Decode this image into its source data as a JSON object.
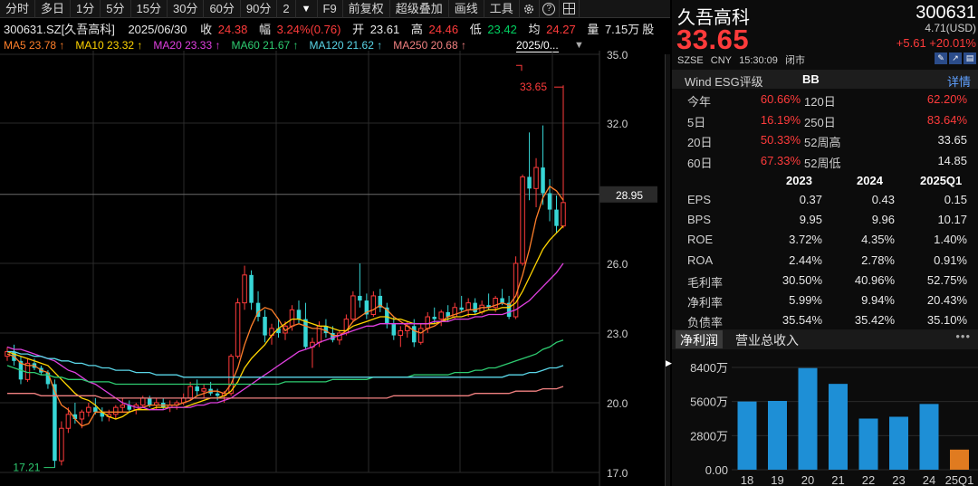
{
  "toolbar": {
    "items": [
      "分时",
      "多日",
      "1分",
      "5分",
      "15分",
      "30分",
      "60分",
      "90分",
      "2"
    ],
    "more_arrow": "▼",
    "f9": "F9",
    "adjust": "前复权",
    "overlay": "超级叠加",
    "draw": "画线",
    "tools": "工具",
    "settings_icon": "gear-icon",
    "help": "?",
    "help_icon": "question-icon",
    "grid_icon": "grid-icon"
  },
  "quote": {
    "code_name": "300631.SZ[久吾高科]",
    "date": "2025/06/30",
    "close_label": "收",
    "close": "24.38",
    "amp_label": "幅",
    "amp": "3.24%(0.76)",
    "open_label": "开",
    "open": "23.61",
    "high_label": "高",
    "high": "24.46",
    "low_label": "低",
    "low": "23.42",
    "avg_label": "均",
    "avg": "24.27",
    "vol_label": "量",
    "vol": "7.15万",
    "trail": "股"
  },
  "ma_legend": [
    {
      "text": "MA5 23.78 ↑",
      "color": "#ff7f2a"
    },
    {
      "text": "MA10 23.32 ↑",
      "color": "#ffd400"
    },
    {
      "text": "MA20 23.33 ↑",
      "color": "#e040e0"
    },
    {
      "text": "MA60 21.67 ↑",
      "color": "#2ecc71"
    },
    {
      "text": "MA120 21.62 ↑",
      "color": "#5ad6e8"
    },
    {
      "text": "MA250 20.68 ↑",
      "color": "#f08080"
    }
  ],
  "ma_date": "2025/0...",
  "ma_drop": "▼",
  "chart_data": {
    "type": "candlestick",
    "y_ticks": [
      "35.0",
      "32.0",
      "26.0",
      "23.0",
      "20.0",
      "17.0"
    ],
    "y_range": [
      17.0,
      35.0
    ],
    "current_price_label": "28.95",
    "current_price": 28.95,
    "high_marker": "33.65",
    "low_marker": "17.21",
    "candles": [
      [
        22.0,
        22.4,
        21.8,
        22.2
      ],
      [
        22.2,
        22.5,
        21.6,
        21.8
      ],
      [
        21.8,
        22.0,
        20.8,
        21.0
      ],
      [
        21.0,
        21.9,
        20.9,
        21.7
      ],
      [
        21.7,
        21.9,
        21.4,
        21.5
      ],
      [
        21.5,
        21.6,
        21.2,
        21.3
      ],
      [
        21.3,
        21.4,
        20.6,
        20.8
      ],
      [
        20.8,
        21.0,
        17.2,
        17.5
      ],
      [
        17.5,
        19.2,
        17.3,
        18.9
      ],
      [
        18.9,
        19.8,
        18.7,
        19.5
      ],
      [
        19.5,
        20.0,
        19.1,
        19.3
      ],
      [
        19.3,
        19.7,
        18.9,
        19.6
      ],
      [
        19.6,
        20.0,
        19.4,
        19.8
      ],
      [
        19.8,
        20.2,
        19.5,
        19.6
      ],
      [
        19.6,
        19.8,
        19.2,
        19.4
      ],
      [
        19.4,
        19.7,
        19.2,
        19.5
      ],
      [
        19.5,
        19.9,
        19.3,
        19.8
      ],
      [
        19.8,
        20.2,
        19.6,
        19.9
      ],
      [
        19.9,
        20.1,
        19.6,
        19.7
      ],
      [
        19.7,
        20.0,
        19.5,
        19.9
      ],
      [
        19.9,
        20.3,
        19.8,
        20.2
      ],
      [
        20.2,
        20.3,
        19.8,
        19.9
      ],
      [
        19.9,
        20.2,
        19.7,
        20.0
      ],
      [
        20.0,
        20.2,
        19.7,
        19.8
      ],
      [
        19.8,
        20.1,
        19.6,
        19.9
      ],
      [
        19.9,
        20.1,
        19.7,
        20.0
      ],
      [
        20.0,
        20.4,
        19.9,
        20.2
      ],
      [
        20.2,
        20.9,
        20.1,
        20.7
      ],
      [
        20.7,
        21.0,
        20.3,
        20.5
      ],
      [
        20.5,
        20.8,
        20.2,
        20.6
      ],
      [
        20.6,
        20.9,
        20.3,
        20.4
      ],
      [
        20.4,
        20.6,
        20.1,
        20.3
      ],
      [
        20.3,
        20.5,
        20.0,
        20.4
      ],
      [
        20.4,
        22.1,
        20.3,
        22.0
      ],
      [
        22.0,
        24.5,
        21.9,
        24.3
      ],
      [
        24.3,
        25.9,
        24.0,
        25.5
      ],
      [
        25.5,
        25.7,
        24.0,
        24.3
      ],
      [
        24.3,
        24.8,
        23.5,
        23.7
      ],
      [
        23.7,
        24.0,
        22.6,
        22.9
      ],
      [
        22.9,
        23.4,
        22.5,
        23.2
      ],
      [
        23.2,
        23.6,
        22.8,
        23.0
      ],
      [
        23.0,
        23.5,
        22.7,
        23.3
      ],
      [
        23.3,
        24.2,
        23.1,
        24.0
      ],
      [
        24.0,
        24.4,
        23.4,
        23.6
      ],
      [
        23.6,
        24.3,
        22.3,
        22.4
      ],
      [
        22.4,
        22.8,
        21.5,
        22.6
      ],
      [
        22.6,
        23.5,
        22.4,
        23.3
      ],
      [
        23.3,
        23.6,
        22.8,
        23.0
      ],
      [
        23.0,
        23.3,
        22.6,
        22.7
      ],
      [
        22.7,
        23.1,
        22.5,
        23.0
      ],
      [
        23.0,
        23.8,
        22.9,
        23.6
      ],
      [
        23.6,
        24.8,
        23.5,
        24.6
      ],
      [
        24.6,
        26.0,
        24.1,
        24.4
      ],
      [
        24.4,
        24.7,
        23.6,
        23.8
      ],
      [
        23.8,
        24.8,
        23.7,
        24.6
      ],
      [
        24.6,
        24.9,
        23.9,
        24.1
      ],
      [
        24.1,
        24.3,
        23.2,
        23.4
      ],
      [
        23.4,
        23.7,
        22.7,
        22.9
      ],
      [
        22.9,
        23.3,
        22.4,
        23.1
      ],
      [
        23.1,
        23.5,
        22.8,
        23.3
      ],
      [
        23.3,
        23.6,
        22.4,
        22.6
      ],
      [
        22.6,
        23.4,
        22.5,
        23.2
      ],
      [
        23.2,
        23.9,
        23.0,
        23.7
      ],
      [
        23.7,
        24.1,
        23.4,
        23.6
      ],
      [
        23.6,
        24.0,
        23.3,
        23.9
      ],
      [
        23.9,
        24.2,
        23.5,
        23.7
      ],
      [
        23.7,
        24.3,
        23.6,
        24.1
      ],
      [
        24.1,
        24.6,
        23.9,
        24.0
      ],
      [
        24.0,
        24.5,
        23.7,
        24.3
      ],
      [
        24.3,
        24.5,
        23.8,
        23.9
      ],
      [
        23.9,
        24.4,
        23.8,
        24.2
      ],
      [
        24.2,
        24.7,
        24.0,
        24.1
      ],
      [
        24.1,
        24.6,
        23.9,
        24.5
      ],
      [
        24.5,
        24.9,
        24.2,
        24.3
      ],
      [
        24.3,
        24.6,
        23.6,
        23.7
      ],
      [
        23.7,
        26.3,
        23.6,
        26.0
      ],
      [
        26.0,
        29.8,
        25.9,
        29.7
      ],
      [
        29.7,
        31.6,
        28.7,
        29.2
      ],
      [
        29.2,
        30.5,
        28.4,
        30.1
      ],
      [
        30.1,
        31.9,
        28.5,
        29.0
      ],
      [
        29.0,
        29.6,
        27.8,
        28.3
      ],
      [
        28.3,
        28.9,
        27.3,
        27.6
      ],
      [
        27.6,
        33.65,
        27.5,
        28.6
      ]
    ],
    "ma_series": [
      {
        "name": "MA5",
        "color": "#ff7f2a",
        "values": [
          22.1,
          22.0,
          21.7,
          21.6,
          21.6,
          21.4,
          21.3,
          20.5,
          19.9,
          19.7,
          19.3,
          19.0,
          19.1,
          19.6,
          19.6,
          19.6,
          19.6,
          19.6,
          19.6,
          19.7,
          19.8,
          19.9,
          19.9,
          19.9,
          19.9,
          19.9,
          20.0,
          20.1,
          20.3,
          20.4,
          20.5,
          20.5,
          20.4,
          20.8,
          21.5,
          22.5,
          23.3,
          23.9,
          24.1,
          24.0,
          23.6,
          23.1,
          23.3,
          23.4,
          23.3,
          23.2,
          23.2,
          23.1,
          22.9,
          22.9,
          23.1,
          23.5,
          23.7,
          23.9,
          24.0,
          24.2,
          24.0,
          23.7,
          23.5,
          23.3,
          23.1,
          23.0,
          23.2,
          23.3,
          23.5,
          23.7,
          23.8,
          23.9,
          24.0,
          24.0,
          24.1,
          24.1,
          24.2,
          24.3,
          24.2,
          24.6,
          25.5,
          26.6,
          27.9,
          28.8,
          29.3,
          29.1,
          28.7
        ]
      },
      {
        "name": "MA10",
        "color": "#ffd400",
        "values": [
          22.2,
          22.1,
          22.0,
          21.9,
          21.8,
          21.7,
          21.6,
          21.3,
          21.0,
          20.7,
          20.4,
          20.2,
          20.1,
          19.9,
          19.6,
          19.4,
          19.3,
          19.4,
          19.6,
          19.7,
          19.7,
          19.7,
          19.8,
          19.8,
          19.8,
          19.8,
          19.8,
          19.9,
          20.0,
          20.1,
          20.2,
          20.2,
          20.3,
          20.5,
          20.9,
          21.5,
          21.9,
          22.2,
          22.5,
          22.9,
          23.2,
          23.4,
          23.6,
          23.6,
          23.5,
          23.4,
          23.3,
          23.3,
          23.2,
          23.1,
          23.1,
          23.3,
          23.4,
          23.5,
          23.6,
          23.7,
          23.7,
          23.6,
          23.6,
          23.5,
          23.4,
          23.4,
          23.4,
          23.4,
          23.5,
          23.6,
          23.7,
          23.7,
          23.8,
          23.8,
          23.9,
          24.0,
          24.0,
          24.1,
          24.1,
          24.3,
          24.8,
          25.4,
          26.0,
          26.6,
          27.0,
          27.3,
          27.6
        ]
      },
      {
        "name": "MA20",
        "color": "#e040e0",
        "values": [
          22.4,
          22.3,
          22.3,
          22.2,
          22.1,
          22.0,
          21.9,
          21.8,
          21.6,
          21.4,
          21.3,
          21.1,
          20.9,
          20.8,
          20.6,
          20.4,
          20.2,
          20.0,
          19.9,
          19.8,
          19.8,
          19.7,
          19.7,
          19.7,
          19.8,
          19.8,
          19.8,
          19.8,
          19.9,
          19.9,
          20.0,
          20.0,
          20.1,
          20.2,
          20.4,
          20.6,
          20.8,
          21.0,
          21.2,
          21.4,
          21.6,
          21.8,
          22.0,
          22.2,
          22.3,
          22.4,
          22.6,
          22.7,
          22.8,
          22.9,
          23.0,
          23.1,
          23.2,
          23.3,
          23.3,
          23.4,
          23.4,
          23.4,
          23.4,
          23.4,
          23.4,
          23.4,
          23.4,
          23.5,
          23.5,
          23.5,
          23.6,
          23.6,
          23.6,
          23.7,
          23.7,
          23.8,
          23.8,
          23.8,
          23.9,
          24.0,
          24.2,
          24.4,
          24.7,
          25.0,
          25.3,
          25.6,
          26.0
        ]
      },
      {
        "name": "MA60",
        "color": "#2ecc71",
        "values": [
          21.6,
          21.5,
          21.4,
          21.3,
          21.3,
          21.2,
          21.2,
          21.1,
          21.1,
          21.0,
          21.0,
          21.0,
          20.9,
          20.9,
          20.9,
          20.9,
          20.8,
          20.8,
          20.8,
          20.8,
          20.8,
          20.8,
          20.8,
          20.8,
          20.8,
          20.8,
          20.8,
          20.8,
          20.8,
          20.8,
          20.8,
          20.8,
          20.8,
          20.8,
          20.8,
          20.8,
          20.8,
          20.8,
          20.8,
          20.8,
          20.8,
          20.9,
          20.9,
          20.9,
          20.9,
          20.9,
          20.9,
          20.9,
          21.0,
          21.0,
          21.0,
          21.0,
          21.0,
          21.0,
          21.1,
          21.1,
          21.1,
          21.1,
          21.1,
          21.1,
          21.2,
          21.2,
          21.2,
          21.2,
          21.2,
          21.2,
          21.3,
          21.3,
          21.3,
          21.4,
          21.4,
          21.5,
          21.5,
          21.6,
          21.7,
          21.8,
          21.9,
          22.0,
          22.1,
          22.3,
          22.4,
          22.6,
          22.7
        ]
      },
      {
        "name": "MA120",
        "color": "#5ad6e8",
        "values": [
          22.2,
          22.2,
          22.1,
          22.1,
          22.0,
          22.0,
          21.9,
          21.9,
          21.8,
          21.8,
          21.7,
          21.7,
          21.6,
          21.6,
          21.5,
          21.5,
          21.4,
          21.4,
          21.4,
          21.3,
          21.3,
          21.3,
          21.2,
          21.2,
          21.2,
          21.2,
          21.1,
          21.1,
          21.1,
          21.1,
          21.1,
          21.1,
          21.1,
          21.1,
          21.1,
          21.1,
          21.1,
          21.1,
          21.1,
          21.1,
          21.1,
          21.1,
          21.1,
          21.1,
          21.1,
          21.1,
          21.1,
          21.1,
          21.1,
          21.1,
          21.1,
          21.1,
          21.1,
          21.1,
          21.1,
          21.1,
          21.1,
          21.1,
          21.1,
          21.1,
          21.1,
          21.1,
          21.1,
          21.1,
          21.1,
          21.1,
          21.1,
          21.1,
          21.1,
          21.1,
          21.1,
          21.1,
          21.1,
          21.1,
          21.2,
          21.2,
          21.2,
          21.3,
          21.3,
          21.4,
          21.5,
          21.5,
          21.6
        ]
      },
      {
        "name": "MA250",
        "color": "#f08080",
        "values": [
          20.4,
          20.4,
          20.4,
          20.4,
          20.4,
          20.3,
          20.3,
          20.3,
          20.3,
          20.3,
          20.3,
          20.3,
          20.3,
          20.3,
          20.2,
          20.2,
          20.2,
          20.2,
          20.2,
          20.2,
          20.2,
          20.2,
          20.2,
          20.2,
          20.2,
          20.2,
          20.2,
          20.2,
          20.2,
          20.2,
          20.2,
          20.2,
          20.2,
          20.2,
          20.2,
          20.2,
          20.2,
          20.2,
          20.2,
          20.2,
          20.2,
          20.2,
          20.2,
          20.2,
          20.2,
          20.2,
          20.2,
          20.2,
          20.2,
          20.2,
          20.2,
          20.2,
          20.2,
          20.2,
          20.2,
          20.2,
          20.2,
          20.3,
          20.3,
          20.3,
          20.3,
          20.3,
          20.3,
          20.3,
          20.3,
          20.3,
          20.3,
          20.3,
          20.3,
          20.4,
          20.4,
          20.4,
          20.4,
          20.4,
          20.4,
          20.5,
          20.5,
          20.5,
          20.5,
          20.6,
          20.6,
          20.6,
          20.7
        ]
      }
    ],
    "colors": {
      "up": "#ff3b3b",
      "down": "#37d6d6",
      "grid": "#2a2a2a",
      "price_line": "#6b6b6b"
    }
  },
  "panel": {
    "name": "久吾高科",
    "code": "300631",
    "price": "33.65",
    "usd": "4.71(USD)",
    "change": "+5.61  +20.01%",
    "exchange": "SZSE",
    "currency": "CNY",
    "time": "15:30:09",
    "status": "闭市",
    "icon1": "✎",
    "icon2": "↗",
    "icon3": "▤",
    "esg_label": "Wind ESG评级",
    "esg_value": "BB",
    "esg_detail": "详情",
    "returns": [
      {
        "l1": "今年",
        "v1": "60.66%",
        "l2": "120日",
        "v2": "62.20%",
        "v2_white": false
      },
      {
        "l1": "5日",
        "v1": "16.19%",
        "l2": "250日",
        "v2": "83.64%",
        "v2_white": false
      },
      {
        "l1": "20日",
        "v1": "50.33%",
        "l2": "52周高",
        "v2": "33.65",
        "v2_white": true
      },
      {
        "l1": "60日",
        "v1": "67.33%",
        "l2": "52周低",
        "v2": "14.85",
        "v2_white": true
      }
    ],
    "fin_years": [
      "2023",
      "2024",
      "2025Q1"
    ],
    "fin_rows": [
      {
        "label": "EPS",
        "v": [
          "0.37",
          "0.43",
          "0.15"
        ]
      },
      {
        "label": "BPS",
        "v": [
          "9.95",
          "9.96",
          "10.17"
        ]
      },
      {
        "label": "ROE",
        "v": [
          "3.72%",
          "4.35%",
          "1.40%"
        ]
      },
      {
        "label": "ROA",
        "v": [
          "2.44%",
          "2.78%",
          "0.91%"
        ]
      },
      {
        "label": "毛利率",
        "v": [
          "30.50%",
          "40.96%",
          "52.75%"
        ]
      },
      {
        "label": "净利率",
        "v": [
          "5.99%",
          "9.94%",
          "20.43%"
        ]
      },
      {
        "label": "负债率",
        "v": [
          "35.54%",
          "35.42%",
          "35.10%"
        ]
      }
    ],
    "tab_active": "净利润",
    "tab_inactive": "营业总收入",
    "tab_more": "•••",
    "side_arrow": "▶"
  },
  "profit_chart": {
    "type": "bar",
    "categories": [
      "18",
      "19",
      "20",
      "21",
      "22",
      "23",
      "24",
      "25Q1"
    ],
    "values": [
      5600,
      5650,
      8350,
      7050,
      4200,
      4350,
      5400,
      1650
    ],
    "y_ticks": [
      "8400万",
      "5600万",
      "2800万",
      "0.00"
    ],
    "y_tick_values": [
      8400,
      5600,
      2800,
      0
    ],
    "ylim": [
      0,
      8400
    ],
    "colors": {
      "bar": "#1e8fd6",
      "last": "#e07b20"
    }
  }
}
